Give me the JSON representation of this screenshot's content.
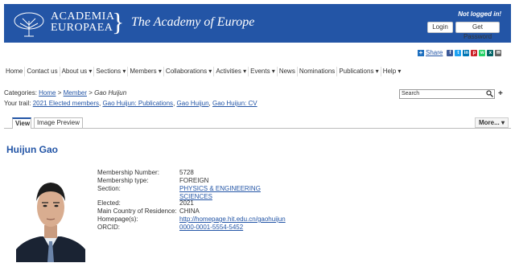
{
  "header": {
    "logo_line1": "ACADEMIA",
    "logo_line2": "EUROPAEA",
    "title": "The Academy of Europe",
    "login_status": "Not logged in!",
    "login_label": "Login",
    "password_label": "Get Password",
    "color": "#2355a6"
  },
  "share": {
    "label": "Share",
    "icons": [
      "facebook-icon",
      "twitter-icon",
      "linkedin-icon",
      "pinterest-icon",
      "whatsapp-icon",
      "xing-icon",
      "email-icon"
    ]
  },
  "nav": [
    "Home",
    "Contact us",
    "About us ▾",
    "Sections ▾",
    "Members ▾",
    "Collaborations ▾",
    "Activities ▾",
    "Events ▾",
    "News",
    "Nominations",
    "Publications ▾",
    "Help ▾"
  ],
  "breadcrumb": {
    "prefix": "Categories:",
    "home": "Home",
    "sep": ">",
    "member": "Member",
    "current": "Gao Huijun"
  },
  "trail": {
    "prefix": "Your trail:",
    "items": [
      "2021 Elected members",
      "Gao Huijun: Publications",
      "Gao Huijun",
      "Gao Huijun: CV"
    ]
  },
  "search": {
    "value": "Search"
  },
  "tabs": {
    "view": "View",
    "image_preview": "Image Preview",
    "more": "More... ▾"
  },
  "person": {
    "name": "Huijun Gao",
    "fields": {
      "membership_number_label": "Membership Number:",
      "membership_number": "5728",
      "membership_type_label": "Membership type:",
      "membership_type": "FOREIGN",
      "section_label": "Section:",
      "section_line1": "PHYSICS & ENGINEERING",
      "section_line2": "SCIENCES",
      "elected_label": "Elected:",
      "elected": "2021",
      "country_label": "Main Country of Residence:",
      "country": "CHINA",
      "homepage_label": "Homepage(s):",
      "homepage": "http://homepage.hit.edu.cn/gaohuijun",
      "orcid_label": "ORCID:",
      "orcid": "0000-0001-5554-5452"
    }
  }
}
